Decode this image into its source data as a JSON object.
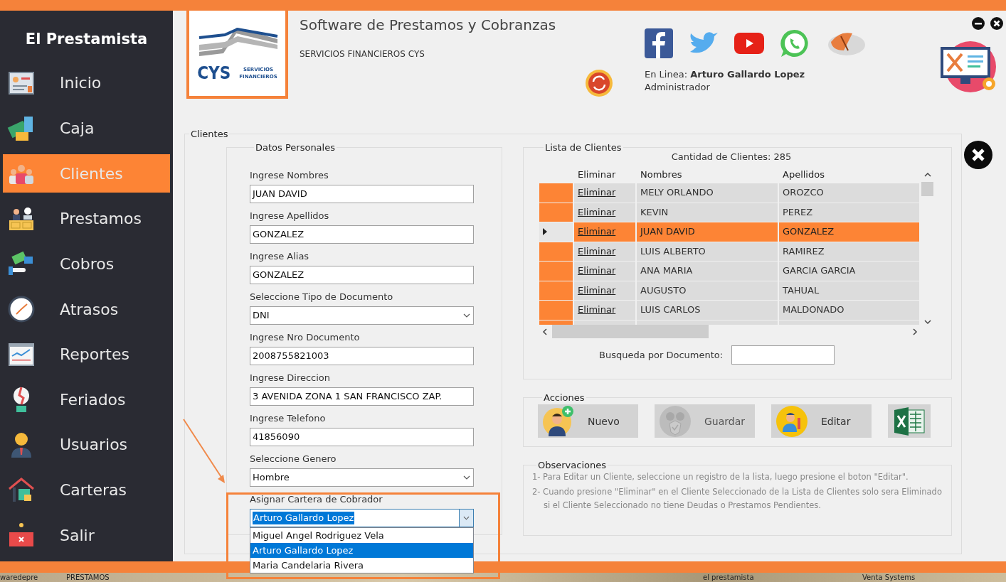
{
  "app": {
    "title": "El Prestamista"
  },
  "sidebar": {
    "items": [
      {
        "label": "Inicio",
        "selected": false
      },
      {
        "label": "Caja",
        "selected": false
      },
      {
        "label": "Clientes",
        "selected": true
      },
      {
        "label": "Prestamos",
        "selected": false
      },
      {
        "label": "Cobros",
        "selected": false
      },
      {
        "label": "Atrasos",
        "selected": false
      },
      {
        "label": "Reportes",
        "selected": false
      },
      {
        "label": "Feriados",
        "selected": false
      },
      {
        "label": "Usuarios",
        "selected": false
      },
      {
        "label": "Carteras",
        "selected": false
      },
      {
        "label": "Salir",
        "selected": false
      }
    ]
  },
  "header": {
    "logo": {
      "mark": "CYS",
      "line_1": "SERVICIOS",
      "line_2": "FINANCIEROS"
    },
    "title": "Software de Prestamos y Cobranzas",
    "subtitle": "SERVICIOS FINANCIEROS  CYS",
    "user_label": "En Linea:",
    "user_name": "Arturo Gallardo Lopez",
    "role": "Administrador"
  },
  "clients": {
    "title": "Clientes",
    "personal_data": {
      "title": "Datos Personales",
      "fields": [
        {
          "kind": "text",
          "label": "Ingrese Nombres",
          "value": "JUAN DAVID"
        },
        {
          "kind": "text",
          "label": "Ingrese Apellidos",
          "value": "GONZALEZ"
        },
        {
          "kind": "text",
          "label": "Ingrese Alias",
          "value": "GONZALEZ"
        },
        {
          "kind": "select",
          "label": "Seleccione Tipo de Documento",
          "value": "DNI",
          "expanded": false
        },
        {
          "kind": "text",
          "label": "Ingrese Nro Documento",
          "value": "2008755821003"
        },
        {
          "kind": "text",
          "label": "Ingrese Direccion",
          "value": "3 AVENIDA ZONA 1 SAN FRANCISCO ZAP."
        },
        {
          "kind": "text",
          "label": "Ingrese Telefono",
          "value": "41856090"
        },
        {
          "kind": "select",
          "label": "Seleccione Genero",
          "value": "Hombre",
          "expanded": false
        },
        {
          "kind": "select",
          "label": "Asignar Cartera de Cobrador",
          "value": "Arturo Gallardo Lopez",
          "expanded": true,
          "options": [
            {
              "label": "Miguel Angel Rodriguez Vela",
              "selected": false
            },
            {
              "label": "Arturo Gallardo Lopez",
              "selected": true
            },
            {
              "label": "Maria Candelaria Rivera",
              "selected": false
            }
          ]
        }
      ]
    },
    "client_list": {
      "title": "Lista de Clientes",
      "count": "Cantidad de Clientes: 285",
      "columns": [
        "Eliminar",
        "Nombres",
        "Apellidos"
      ],
      "rows": [
        {
          "action": "Eliminar",
          "nombres": "MELY ORLANDO",
          "apellidos": "OROZCO",
          "selected": false
        },
        {
          "action": "Eliminar",
          "nombres": "KEVIN",
          "apellidos": "PEREZ",
          "selected": false
        },
        {
          "action": "Eliminar",
          "nombres": "JUAN DAVID",
          "apellidos": "GONZALEZ",
          "selected": true
        },
        {
          "action": "Eliminar",
          "nombres": "LUIS ALBERTO",
          "apellidos": "RAMIREZ",
          "selected": false
        },
        {
          "action": "Eliminar",
          "nombres": "ANA MARIA",
          "apellidos": "GARCIA GARCIA",
          "selected": false
        },
        {
          "action": "Eliminar",
          "nombres": "AUGUSTO",
          "apellidos": "TAHUAL",
          "selected": false
        },
        {
          "action": "Eliminar",
          "nombres": "LUIS CARLOS",
          "apellidos": "MALDONADO",
          "selected": false
        }
      ],
      "search_label": "Busqueda por Documento:"
    },
    "actions": {
      "title": "Acciones",
      "buttons": [
        {
          "kind": "new",
          "label": "Nuevo",
          "disabled": false
        },
        {
          "kind": "save",
          "label": "Guardar",
          "disabled": true
        },
        {
          "kind": "edit",
          "label": "Editar",
          "disabled": false
        },
        {
          "kind": "excel",
          "disabled": false
        }
      ]
    },
    "observations": {
      "title": "Observaciones",
      "items": [
        "1- Para Editar un Cliente, seleccione un registro de la lista, luego presione el boton \"Editar\".",
        "2- Cuando presione \"Eliminar\" en el Cliente Seleccionado de la Lista de Clientes solo sera Eliminado si el Cliente Seleccionado no tiene Deudas o Prestamos Pendientes."
      ]
    }
  },
  "taskbar": {
    "items": [
      "waredepre",
      "PRESTAMOS",
      "el prestamista",
      "Venta Systems"
    ]
  }
}
